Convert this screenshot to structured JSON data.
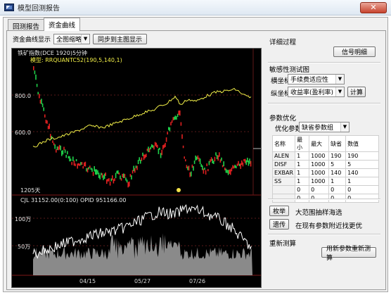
{
  "window": {
    "title": "模型回测报告",
    "close_glyph": "✕"
  },
  "tabs": [
    {
      "label": "回测报告"
    },
    {
      "label": "资金曲线"
    }
  ],
  "toolbar": {
    "display_label": "资金曲线显示",
    "display_select": "全图缩略",
    "sync_button": "同步到主图显示"
  },
  "chart": {
    "header": "铁矿指数(DCE 1920)5分钟",
    "model_line": "模型: RRQUANTC52(190,5,140,1)",
    "y_labels": [
      "800.0",
      "600.0"
    ],
    "bottom_left_label": "1205天",
    "volume_header": "CJL   31152.00(0:100)    OPID 951166.00",
    "volume_y_labels": [
      "100万",
      "50万"
    ],
    "x_labels": [
      "04/15",
      "05/27",
      "07/26"
    ]
  },
  "right": {
    "details_title": "详细过程",
    "signal_button": "信号明细",
    "sensitivity_title": "敏感性测试图",
    "x_axis_label": "横坐标",
    "x_axis_select": "手续费适应性",
    "y_axis_label": "纵坐标",
    "y_axis_select": "收益率(盈利率)",
    "calc_button": "计算",
    "opt_title": "参数优化",
    "opt_param_label": "优化参数",
    "opt_param_select": "缺省参数组",
    "table_headers": [
      "名称",
      "最小",
      "最大",
      "缺省",
      "数值"
    ],
    "table_rows": [
      [
        "ALEN",
        "1",
        "1000",
        "190",
        "190"
      ],
      [
        "DISF",
        "1",
        "1000",
        "5",
        "5"
      ],
      [
        "EXBAR",
        "1",
        "1000",
        "140",
        "140"
      ],
      [
        "SS",
        "1",
        "1000",
        "1",
        "1"
      ],
      [
        "",
        "0",
        "0",
        "0",
        "0"
      ],
      [
        "",
        "0",
        "0",
        "0",
        "0"
      ]
    ],
    "exhaustive_button": "枚举",
    "exhaustive_desc": "大范围抽样海选",
    "genetic_button": "遗传",
    "genetic_desc": "在现有参数附近找更优",
    "retest_title": "重新测算",
    "retest_button": "用新参数重新测算"
  }
}
